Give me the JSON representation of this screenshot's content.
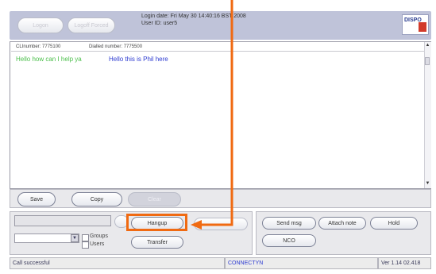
{
  "header": {
    "btn_1": "Logon",
    "btn_2": "Logoff Forced",
    "login_date": "Login date: Fri May 30 14:40:16 BST 2008",
    "user_id": "User ID: user5",
    "logo_text": "DISPO"
  },
  "chat": {
    "cli_number": "CLInumber: 7775100",
    "dialled_number": "Dialled number: 7775500",
    "agent_msg": "Hello how can I help ya",
    "caller_msg": "Hello this is Phil here",
    "agent_color": "#4bbf4b",
    "caller_color": "#2d3bd1"
  },
  "toolbar": {
    "save": "Save",
    "copy": "Copy",
    "clear": "Clear"
  },
  "call_controls": {
    "hangup": "Hangup",
    "transfer": "Transfer",
    "groups_label": "Groups",
    "users_label": "Users"
  },
  "actions": {
    "send_msg": "Send msg",
    "attach_note": "Attach note",
    "hold": "Hold",
    "nco": "NCO"
  },
  "status": {
    "left": "Call successful",
    "middle": "CONNECTYN",
    "right": "Ver 1.14 02.418",
    "middle_color": "#2d3bd1"
  },
  "annotation": {
    "color": "#f06a12"
  }
}
